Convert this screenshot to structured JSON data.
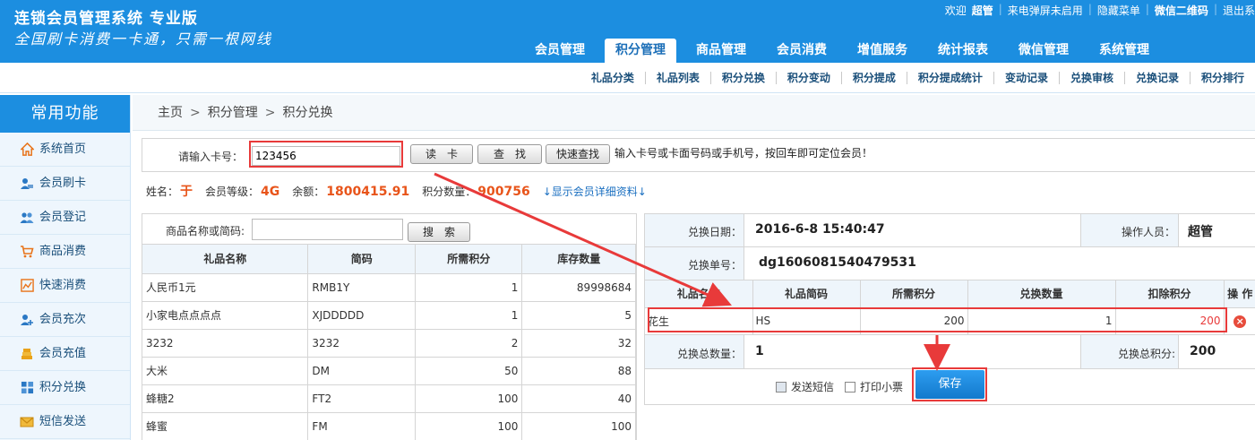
{
  "header": {
    "title": "连锁会员管理系统 专业版",
    "slogan": "全国刷卡消费一卡通，只需一根网线",
    "topbar": [
      "欢迎",
      "超管",
      "来电弹屏未启用",
      "隐藏菜单",
      "微信二维码",
      "退出系"
    ],
    "nav": [
      "会员管理",
      "积分管理",
      "商品管理",
      "会员消费",
      "增值服务",
      "统计报表",
      "微信管理",
      "系统管理"
    ],
    "active_nav": "积分管理"
  },
  "subnav": [
    "礼品分类",
    "礼品列表",
    "积分兑换",
    "积分变动",
    "积分提成",
    "积分提成统计",
    "变动记录",
    "兑换审核",
    "兑换记录",
    "积分排行"
  ],
  "sidebar": {
    "title": "常用功能",
    "items": [
      {
        "label": "系统首页",
        "icon": "home-icon"
      },
      {
        "label": "会员刷卡",
        "icon": "user-card-icon"
      },
      {
        "label": "会员登记",
        "icon": "users-icon"
      },
      {
        "label": "商品消费",
        "icon": "cart-icon"
      },
      {
        "label": "快速消费",
        "icon": "chart-icon"
      },
      {
        "label": "会员充次",
        "icon": "user-add-icon"
      },
      {
        "label": "会员充值",
        "icon": "coins-icon"
      },
      {
        "label": "积分兑换",
        "icon": "grid-icon"
      },
      {
        "label": "短信发送",
        "icon": "mail-icon"
      }
    ]
  },
  "breadcrumb": [
    "主页",
    "积分管理",
    "积分兑换"
  ],
  "card": {
    "label": "请输入卡号：",
    "value": "123456",
    "read_btn": "读　卡",
    "find_btn": "查　找",
    "quick_btn": "快速查找",
    "hint": "输入卡号或卡面号码或手机号，按回车即可定位会员！"
  },
  "member": {
    "name_label": "姓名：",
    "name": "于",
    "level_label": "会员等级：",
    "level": "4G",
    "balance_label": "余额：",
    "balance": "1800415.91",
    "points_label": "积分数量：",
    "points": "900756",
    "detail_link": "↓显示会员详细资料↓"
  },
  "gift_search": {
    "label": "商品名称或简码:",
    "button": "搜　索"
  },
  "gift_table": {
    "headers": [
      "礼品名称",
      "简码",
      "所需积分",
      "库存数量"
    ],
    "rows": [
      [
        "人民币1元",
        "RMB1Y",
        "1",
        "89998684"
      ],
      [
        "小家电点点点点",
        "XJDDDDD",
        "1",
        "5"
      ],
      [
        "3232",
        "3232",
        "2",
        "32"
      ],
      [
        "大米",
        "DM",
        "50",
        "88"
      ],
      [
        "蜂糖2",
        "FT2",
        "100",
        "40"
      ],
      [
        "蜂蜜",
        "FM",
        "100",
        "100"
      ]
    ]
  },
  "exchange": {
    "date_label": "兑换日期：",
    "date": "2016-6-8 15:40:47",
    "operator_label": "操作人员：",
    "operator": "超管",
    "order_label": "兑换单号：",
    "order": "dg1606081540479531",
    "headers": [
      "礼品名称",
      "礼品简码",
      "所需积分",
      "兑换数量",
      "扣除积分",
      "操 作"
    ],
    "row": {
      "name": "花生",
      "code": "HS",
      "points": "200",
      "qty": "1",
      "deduct": "200"
    },
    "total_qty_label": "兑换总数量：",
    "total_qty": "1",
    "total_points_label": "兑换总积分:",
    "total_points": "200",
    "sms_label": "发送短信",
    "print_label": "打印小票",
    "save_label": "保存"
  },
  "colors": {
    "header": "#1c8ee0",
    "highlight": "#e83a3a",
    "accent_value": "#e8541a"
  }
}
